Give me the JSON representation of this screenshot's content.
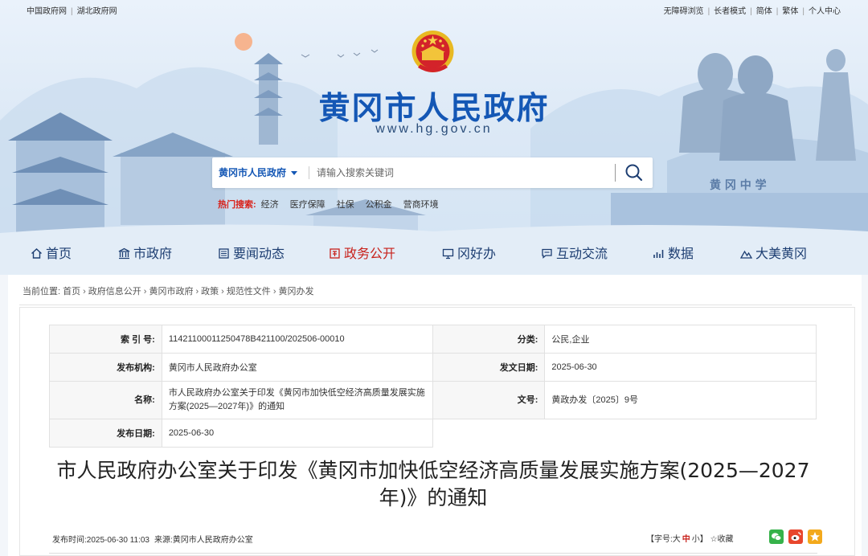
{
  "top_links": {
    "left": [
      "中国政府网",
      "湖北政府网"
    ],
    "right": [
      "无障碍浏览",
      "长者模式",
      "简体",
      "繁体",
      "个人中心"
    ]
  },
  "header": {
    "title": "黄冈市人民政府",
    "url": "www.hg.gov.cn",
    "school_sign": "黄 冈 中 学"
  },
  "search": {
    "scope": "黄冈市人民政府",
    "placeholder": "请输入搜索关键词"
  },
  "hot_search": {
    "label": "热门搜索:",
    "keywords": [
      "经济",
      "医疗保障",
      "社保",
      "公积金",
      "营商环境"
    ]
  },
  "nav": {
    "items": [
      {
        "label": "首页",
        "icon": "home-icon"
      },
      {
        "label": "市政府",
        "icon": "government-building-icon"
      },
      {
        "label": "要闻动态",
        "icon": "newspaper-icon"
      },
      {
        "label": "政务公开",
        "icon": "public-affairs-icon"
      },
      {
        "label": "冈好办",
        "icon": "monitor-icon"
      },
      {
        "label": "互动交流",
        "icon": "chat-icon"
      },
      {
        "label": "数据",
        "icon": "chart-icon"
      },
      {
        "label": "大美黄冈",
        "icon": "mountain-icon"
      }
    ],
    "active_label": "政务公开",
    "active_color": "#c8211b",
    "text_color": "#1d3e72"
  },
  "breadcrumb": {
    "prefix": "当前位置:",
    "items": [
      "首页",
      "政府信息公开",
      "黄冈市政府",
      "政策",
      "规范性文件",
      "黄冈办发"
    ]
  },
  "meta": {
    "index_label": "索 引 号:",
    "index_value": "11421100011250478B421100/202506-00010",
    "category_label": "分类:",
    "category_value": "公民,企业",
    "issuer_label": "发布机构:",
    "issuer_value": "黄冈市人民政府办公室",
    "doc_date_label": "发文日期:",
    "doc_date_value": "2025-06-30",
    "name_label": "名称:",
    "name_value": "市人民政府办公室关于印发《黄冈市加快低空经济高质量发展实施方案(2025—2027年)》的通知",
    "doc_no_label": "文号:",
    "doc_no_value": "黄政办发〔2025〕9号",
    "pub_date_label": "发布日期:",
    "pub_date_value": "2025-06-30"
  },
  "document": {
    "title": "市人民政府办公室关于印发《黄冈市加快低空经济高质量发展实施方案(2025—2027年)》的通知",
    "publish_time_label": "发布时间:",
    "publish_time": "2025-06-30 11:03",
    "source_label": "来源:",
    "source": "黄冈市人民政府办公室"
  },
  "font_size": {
    "open": "【字号:",
    "large": "大",
    "medium": "中",
    "small": "小",
    "close": "】",
    "favorite": "收藏"
  },
  "colors": {
    "brand_blue": "#1457b5",
    "hot_red": "#d9221b",
    "wechat": "#36b24a",
    "weibo": "#e8462c",
    "qzone": "#f3a91c"
  }
}
